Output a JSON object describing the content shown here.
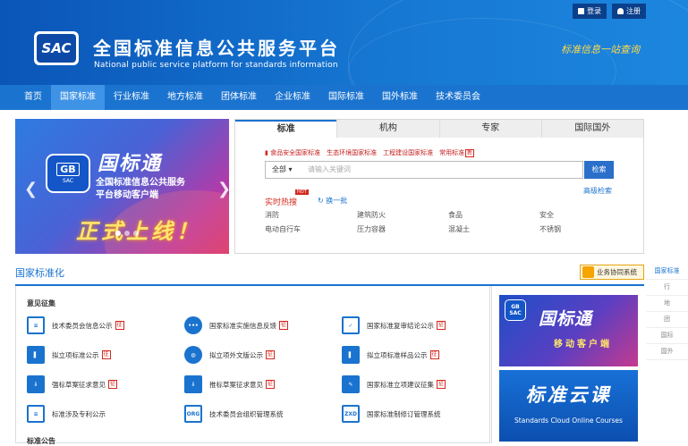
{
  "header": {
    "login": "登录",
    "register": "注册",
    "logo_text": "SAC",
    "title_cn": "全国标准信息公共服务平台",
    "title_en": "National public service platform  for standards information",
    "slogan": "标准信息一站查询"
  },
  "nav": {
    "items": [
      "首页",
      "国家标准",
      "行业标准",
      "地方标准",
      "团体标准",
      "企业标准",
      "国际标准",
      "国外标准",
      "技术委员会"
    ],
    "active_index": 1
  },
  "banner": {
    "gb": "GB",
    "sac": "SAC",
    "title": "国标通",
    "sub1": "全国标准信息公共服务",
    "sub2": "平台移动客户端",
    "launch": "正式上线！"
  },
  "search": {
    "tabs": [
      "标准",
      "机构",
      "专家",
      "国际国外"
    ],
    "quick_links": [
      "食品安全国家标准",
      "生态环境国家标准",
      "工程建设国家标准",
      "常用标准"
    ],
    "new_badge": "新",
    "scope": "全部 ▾",
    "placeholder": "请输入关键词",
    "button": "检索",
    "advanced": "高级检索",
    "hot_label": "实时热搜",
    "hot_badge": "HOT",
    "refresh": "换一批",
    "hot_terms": [
      "消防",
      "建筑防火",
      "食品",
      "安全",
      "电动自行车",
      "压力容器",
      "混凝土",
      "不锈钢"
    ]
  },
  "section": {
    "title": "国家标准化",
    "biz_button": "业务协同系统",
    "rail": [
      "国家标准",
      "行",
      "地",
      "团",
      "国际",
      "国外"
    ]
  },
  "opinion": {
    "title": "意见征集",
    "zheng": "征",
    "items": [
      {
        "label": "技术委员会信息公示",
        "icon": "id-card-icon",
        "glyph": "≡",
        "style": "box",
        "zheng": true
      },
      {
        "label": "国家标准实施信息反馈",
        "icon": "chat-bubble-icon",
        "glyph": "•••",
        "style": "circle",
        "zheng": true
      },
      {
        "label": "国家标准复审结论公示",
        "icon": "document-check-icon",
        "glyph": "✓",
        "style": "box",
        "zheng": true
      },
      {
        "label": "拟立项标准公示",
        "icon": "book-icon",
        "glyph": "▌",
        "style": "sq",
        "zheng": true
      },
      {
        "label": "拟立项外文版公示",
        "icon": "globe-icon",
        "glyph": "◍",
        "style": "circle",
        "zheng": true
      },
      {
        "label": "拟立项标准样品公示",
        "icon": "book-icon",
        "glyph": "▌",
        "style": "sq",
        "zheng": true
      },
      {
        "label": "强标草案征求意见",
        "icon": "download-tray-icon",
        "glyph": "⇩",
        "style": "sq",
        "zheng": true
      },
      {
        "label": "推标草案征求意见",
        "icon": "download-tray-icon",
        "glyph": "⇩",
        "style": "sq",
        "zheng": true
      },
      {
        "label": "国家标准立项建议征集",
        "icon": "edit-icon",
        "glyph": "✎",
        "style": "sq",
        "zheng": true
      },
      {
        "label": "标准涉及专利公示",
        "icon": "list-document-icon",
        "glyph": "≡",
        "style": "box",
        "zheng": false
      },
      {
        "label": "技术委员会组织管理系统",
        "icon": "org-icon",
        "glyph": "ORG",
        "style": "box",
        "zheng": false
      },
      {
        "label": "国家标准制修订管理系统",
        "icon": "zxd-icon",
        "glyph": "ZXD",
        "style": "box",
        "zheng": false
      }
    ],
    "next_title": "标准公告"
  },
  "promo": {
    "p1_gb": "GB",
    "p1_sac": "SAC",
    "p1_title": "国标通",
    "p1_sub": "移动客户端",
    "p2_title": "标准云课",
    "p2_sub": "Standards Cloud Online Courses"
  }
}
